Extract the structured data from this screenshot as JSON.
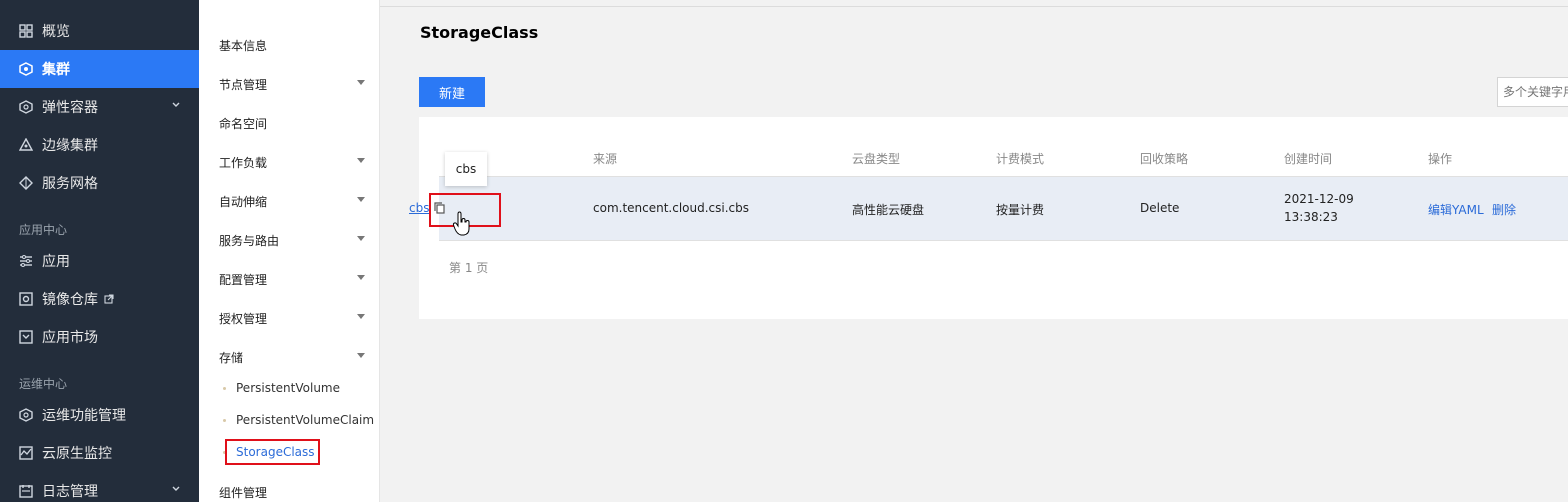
{
  "sidebar": {
    "items": [
      {
        "label": "概览",
        "icon": "grid-icon"
      },
      {
        "label": "集群",
        "icon": "cluster-icon",
        "active": true
      },
      {
        "label": "弹性容器",
        "icon": "elastic-container-icon"
      },
      {
        "label": "边缘集群",
        "icon": "edge-cluster-icon"
      },
      {
        "label": "服务网格",
        "icon": "service-mesh-icon"
      },
      {
        "label": "应用",
        "icon": "app-icon"
      },
      {
        "label": "镜像仓库",
        "icon": "image-repo-icon"
      },
      {
        "label": "应用市场",
        "icon": "app-market-icon"
      },
      {
        "label": "运维功能管理",
        "icon": "ops-icon"
      },
      {
        "label": "云原生监控",
        "icon": "monitor-icon"
      },
      {
        "label": "日志管理",
        "icon": "log-icon"
      }
    ],
    "groups": {
      "app_center": "应用中心",
      "ops_center": "运维中心"
    }
  },
  "subnav": {
    "items": [
      "基本信息",
      "节点管理",
      "命名空间",
      "工作负载",
      "自动伸缩",
      "服务与路由",
      "配置管理",
      "授权管理",
      "存储",
      "组件管理"
    ],
    "storage_children": [
      "PersistentVolume",
      "PersistentVolumeClaim",
      "StorageClass"
    ]
  },
  "main": {
    "title": "StorageClass",
    "new_button": "新建",
    "search_placeholder": "多个关键字用",
    "table": {
      "headers": [
        "来源",
        "云盘类型",
        "计费模式",
        "回收策略",
        "创建时间",
        "操作"
      ],
      "row": {
        "name": "cbs",
        "source": "com.tencent.cloud.csi.cbs",
        "disk_type": "高性能云硬盘",
        "billing": "按量计费",
        "reclaim": "Delete",
        "created_date": "2021-12-09",
        "created_time": "13:38:23",
        "action_edit": "编辑YAML",
        "action_delete": "删除"
      }
    },
    "pager": "第 1 页",
    "tooltip": "cbs"
  }
}
